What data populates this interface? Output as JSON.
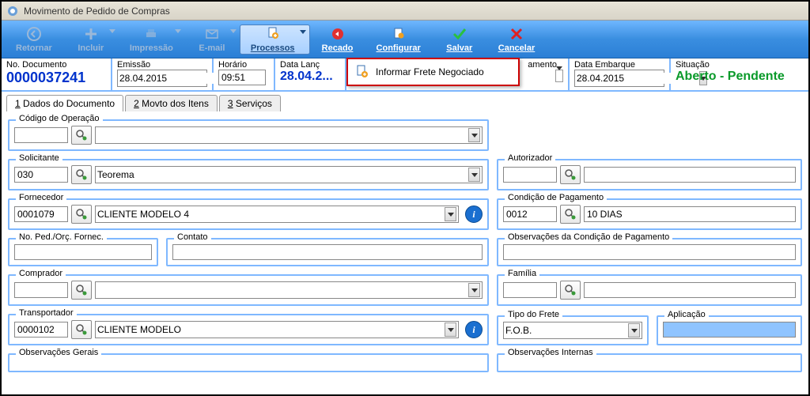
{
  "window": {
    "title": "Movimento de Pedido de Compras"
  },
  "toolbar": {
    "retornar": "Retornar",
    "incluir": "Incluir",
    "impressao": "Impressão",
    "email": "E-mail",
    "processos": "Processos",
    "recado": "Recado",
    "configurar": "Configurar",
    "salvar": "Salvar",
    "cancelar": "Cancelar"
  },
  "header": {
    "no_doc_label": "No. Documento",
    "no_doc_value": "0000037241",
    "emissao_label": "Emissão",
    "emissao_value": "28.04.2015",
    "horario_label": "Horário",
    "horario_value": "09:51",
    "data_lanc_label": "Data Lanç",
    "data_lanc_value": "28.04.2...",
    "amento_label": "amento",
    "data_embarque_label": "Data Embarque",
    "data_embarque_value": "28.04.2015",
    "situacao_label": "Situação",
    "situacao_value": "Aberto - Pendente"
  },
  "tabs": {
    "t1": "Dados do Documento",
    "t2": "Movto dos Itens",
    "t3": "Serviços"
  },
  "menu": {
    "item1": "Informar Frete Negociado"
  },
  "form": {
    "codigo_operacao": {
      "label": "Código de Operação",
      "code": "",
      "desc": ""
    },
    "solicitante": {
      "label": "Solicitante",
      "code": "030",
      "desc": "Teorema"
    },
    "autorizador": {
      "label": "Autorizador",
      "code": "",
      "desc": ""
    },
    "fornecedor": {
      "label": "Fornecedor",
      "code": "0001079",
      "desc": "CLIENTE MODELO 4"
    },
    "cond_pag": {
      "label": "Condição de Pagamento",
      "code": "0012",
      "desc": "10 DIAS"
    },
    "no_ped_orc": {
      "label": "No. Ped./Orç. Fornec.",
      "value": ""
    },
    "contato": {
      "label": "Contato",
      "value": ""
    },
    "obs_cond_pag": {
      "label": "Observações da Condição de Pagamento",
      "value": ""
    },
    "comprador": {
      "label": "Comprador",
      "code": "",
      "desc": ""
    },
    "familia": {
      "label": "Família",
      "code": "",
      "desc": ""
    },
    "transportador": {
      "label": "Transportador",
      "code": "0000102",
      "desc": "CLIENTE MODELO"
    },
    "tipo_frete": {
      "label": "Tipo do Frete",
      "value": "F.O.B."
    },
    "aplicacao": {
      "label": "Aplicação",
      "value": ""
    },
    "obs_gerais": {
      "label": "Observações Gerais"
    },
    "obs_internas": {
      "label": "Observações Internas"
    }
  }
}
